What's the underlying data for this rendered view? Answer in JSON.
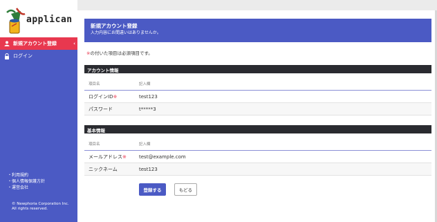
{
  "app": {
    "name": "applican"
  },
  "sidebar": {
    "items": [
      {
        "label": "新規アカウント登録",
        "icon": "user-icon",
        "active": true
      },
      {
        "label": "ログイン",
        "icon": "lock-icon",
        "active": false
      }
    ],
    "footer_links": [
      "利用規約",
      "個人情報保護方針",
      "運営会社"
    ],
    "copyright_line1": "© Newphoria Corporation Inc.",
    "copyright_line2": "All rights reserved."
  },
  "header": {
    "title": "新規アカウント登録",
    "subtitle": "入力内容にお間違いはありませんか。"
  },
  "note": {
    "mark": "※",
    "text": "の付いた項目は必須項目です。"
  },
  "sections": [
    {
      "title": "アカウント情報",
      "col_item": "項目名",
      "col_entry": "記入欄",
      "rows": [
        {
          "label": "ログインID",
          "required": true,
          "value": "test123"
        },
        {
          "label": "パスワード",
          "required": false,
          "value": "t*****3"
        }
      ]
    },
    {
      "title": "基本情報",
      "col_item": "項目名",
      "col_entry": "記入欄",
      "rows": [
        {
          "label": "メールアドレス",
          "required": true,
          "value": "test@example.com"
        },
        {
          "label": "ニックネーム",
          "required": false,
          "value": "test123"
        }
      ]
    }
  ],
  "buttons": {
    "submit": "登録する",
    "back": "もどる"
  },
  "required_mark": "※",
  "colors": {
    "accent": "#4b5ac4",
    "active": "#e8384f",
    "section_bar": "#2a2b30"
  }
}
